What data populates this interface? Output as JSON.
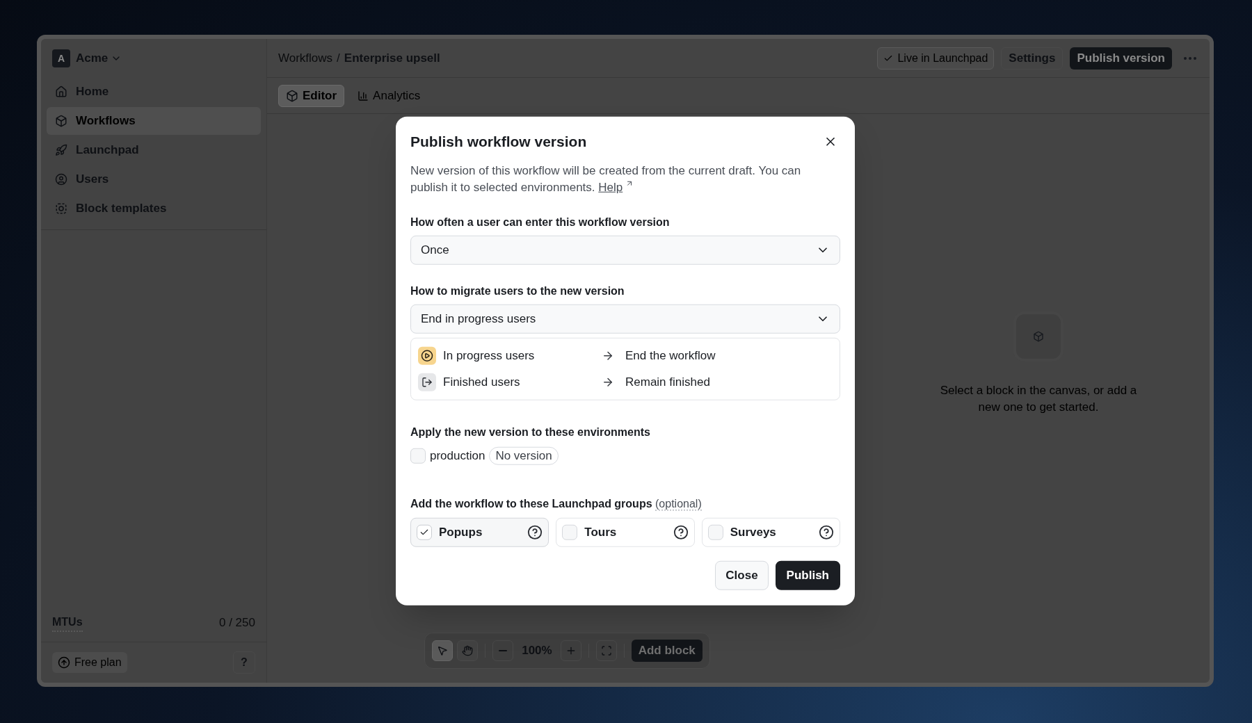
{
  "workspace": {
    "initial": "A",
    "name": "Acme"
  },
  "sidebar": {
    "items": [
      {
        "label": "Home",
        "selected": false
      },
      {
        "label": "Workflows",
        "selected": true
      },
      {
        "label": "Launchpad",
        "selected": false
      },
      {
        "label": "Users",
        "selected": false
      },
      {
        "label": "Block templates",
        "selected": false
      }
    ],
    "usage": {
      "label": "MTUs",
      "value": "0 / 250"
    },
    "plan": "Free plan",
    "help": "?"
  },
  "header": {
    "breadcrumb": [
      "Workflows",
      "Enterprise upsell"
    ],
    "separator": "/",
    "status": "Live in Launchpad",
    "settings": "Settings",
    "publish": "Publish version"
  },
  "tabs": [
    {
      "label": "Editor",
      "selected": true
    },
    {
      "label": "Analytics",
      "selected": false
    }
  ],
  "canvas": {
    "empty_state": "Select a block in the canvas, or add a new one to get started.",
    "tools": [
      {
        "kind": "pointer",
        "selected": true
      },
      {
        "kind": "hand",
        "selected": false
      }
    ],
    "zoom": "100%",
    "add_block": "Add block"
  },
  "dialog": {
    "title": "Publish workflow version",
    "description": "New version of this workflow will be created from the current draft. You can publish it to selected environments.",
    "help_link": "Help",
    "frequency": {
      "label": "How often a user can enter this workflow version",
      "value": "Once"
    },
    "migration": {
      "label": "How to migrate users to the new version",
      "value": "End in progress users",
      "rows": [
        {
          "kind": "in_progress",
          "from": "In progress users",
          "to": "End the workflow"
        },
        {
          "kind": "finished",
          "from": "Finished users",
          "to": "Remain finished"
        }
      ]
    },
    "environments": {
      "label": "Apply the new version to these environments",
      "items": [
        {
          "name": "production",
          "checked": false,
          "badge": "No version"
        }
      ]
    },
    "groups": {
      "label": "Add the workflow to these Launchpad groups",
      "optional": "(optional)",
      "items": [
        {
          "label": "Popups",
          "checked": true
        },
        {
          "label": "Tours",
          "checked": false
        },
        {
          "label": "Surveys",
          "checked": false
        }
      ]
    },
    "buttons": {
      "close": "Close",
      "publish": "Publish"
    }
  }
}
